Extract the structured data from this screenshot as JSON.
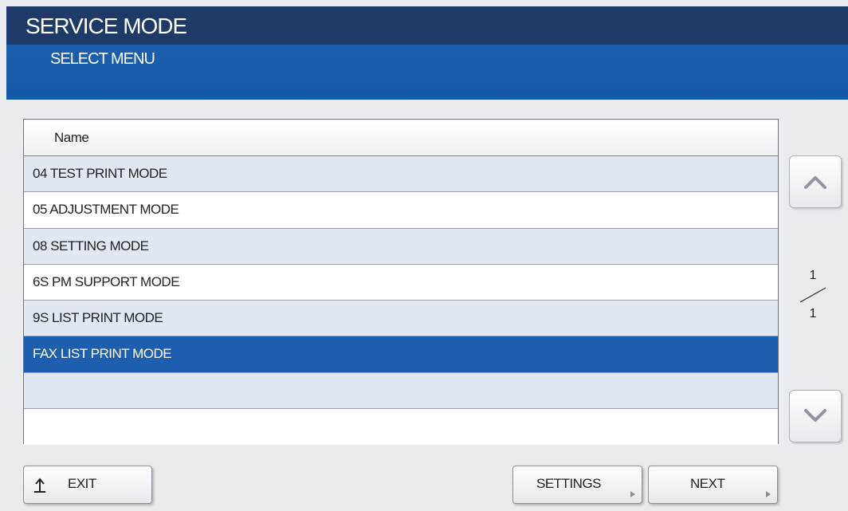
{
  "header": {
    "title": "SERVICE MODE",
    "subtitle": "SELECT MENU"
  },
  "table": {
    "column_header": "Name",
    "rows": [
      {
        "label": "04 TEST PRINT MODE",
        "selected": false
      },
      {
        "label": "05 ADJUSTMENT MODE",
        "selected": false
      },
      {
        "label": "08 SETTING MODE",
        "selected": false
      },
      {
        "label": "6S PM SUPPORT MODE",
        "selected": false
      },
      {
        "label": "9S LIST PRINT MODE",
        "selected": false
      },
      {
        "label": "FAX LIST PRINT MODE",
        "selected": true
      },
      {
        "label": "",
        "selected": false
      },
      {
        "label": "",
        "selected": false
      }
    ]
  },
  "pager": {
    "current": "1",
    "total": "1"
  },
  "buttons": {
    "exit": "EXIT",
    "settings": "SETTINGS",
    "next": "NEXT"
  },
  "colors": {
    "header_dark": "#1f3a68",
    "header_blue": "#1459a8",
    "selected_row": "#1d5fae",
    "alt_row": "#e2e8f2"
  }
}
